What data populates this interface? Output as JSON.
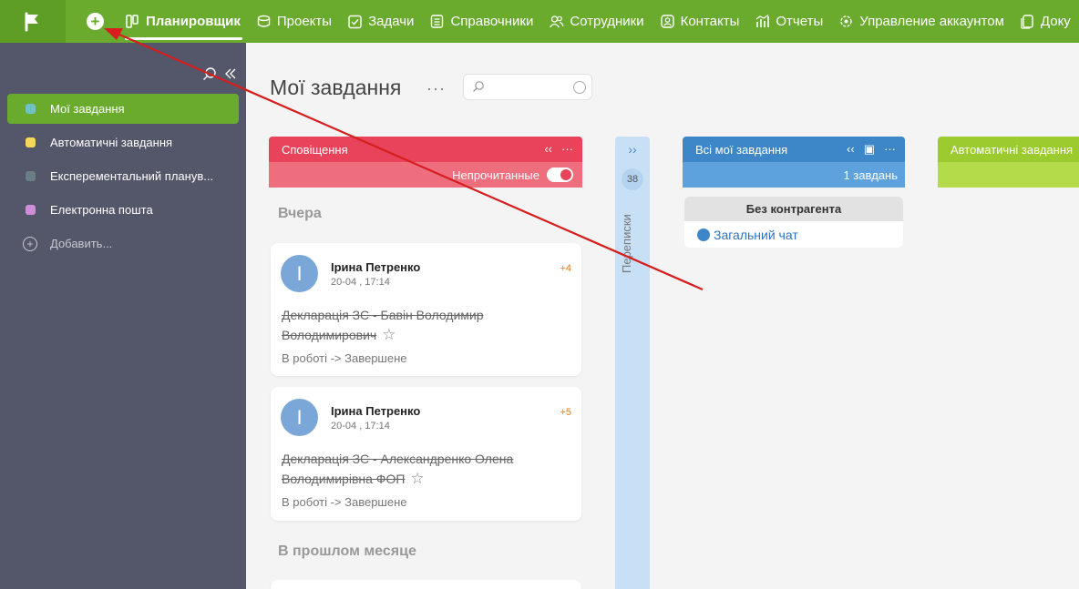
{
  "nav": {
    "items": [
      {
        "label": "Планировщик",
        "icon": "planner-icon"
      },
      {
        "label": "Проекты",
        "icon": "projects-icon"
      },
      {
        "label": "Задачи",
        "icon": "tasks-icon"
      },
      {
        "label": "Справочники",
        "icon": "directories-icon"
      },
      {
        "label": "Сотрудники",
        "icon": "employees-icon"
      },
      {
        "label": "Контакты",
        "icon": "contacts-icon"
      },
      {
        "label": "Отчеты",
        "icon": "reports-icon"
      },
      {
        "label": "Управление аккаунтом",
        "icon": "account-icon"
      },
      {
        "label": "Доку",
        "icon": "documents-icon"
      }
    ],
    "colors": {
      "bar": "#6aab2e",
      "logo_bg": "#5f9e24"
    }
  },
  "sidebar": {
    "items": [
      {
        "label": "Мої завдання",
        "color": "#6fc1c4",
        "active": true
      },
      {
        "label": "Автоматичні завдання",
        "color": "#f7d95a",
        "active": false
      },
      {
        "label": "Експерементальний планув...",
        "color": "#6a7e86",
        "active": false
      },
      {
        "label": "Електронна пошта",
        "color": "#cf8fd8",
        "active": false
      }
    ],
    "add_label": "Добавить..."
  },
  "main": {
    "title": "Мої завдання",
    "more": "···"
  },
  "notifications": {
    "title": "Сповіщення",
    "filter_label": "Непрочитанные",
    "filter_on": true,
    "color": "#e8435a",
    "groups": [
      {
        "label": "Вчера",
        "cards": [
          {
            "avatar": "І",
            "name": "Ірина Петренко",
            "date": "20-04 , 17:14",
            "count": "+4",
            "title": "Декларація ЗС - Бавін Володимир Володимирович",
            "status": "В роботі -> Завершене"
          },
          {
            "avatar": "І",
            "name": "Ірина Петренко",
            "date": "20-04 , 17:14",
            "count": "+5",
            "title": "Декларація ЗС - Александренко Олена Володимирівна ФОП",
            "status": "В роботі -> Завершене"
          }
        ]
      },
      {
        "label": "В прошлом месяце",
        "cards": []
      }
    ]
  },
  "collapsed_column": {
    "badge": "38",
    "label": "Переписки",
    "color": "#c7e0f6"
  },
  "my_tasks": {
    "title": "Всі мої завдання",
    "count_label": "1 завдань",
    "color": "#3d87c8",
    "contractor_group": "Без контрагента",
    "chat_link": "Загальний чат"
  },
  "auto_tasks": {
    "title": "Автоматичні завдання",
    "color": "#9ccb2f"
  }
}
